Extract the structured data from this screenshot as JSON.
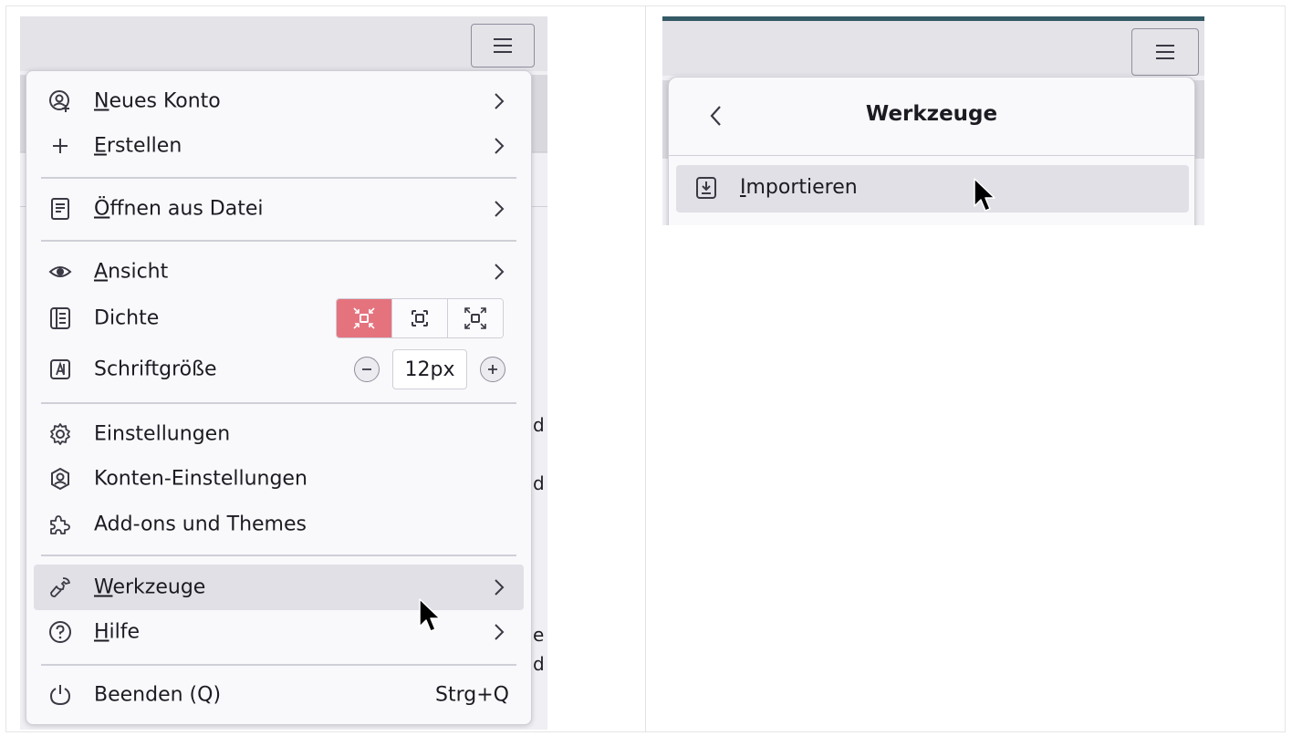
{
  "left_menu": {
    "items": {
      "new_account": {
        "label_u": "N",
        "label_rest": "eues Konto"
      },
      "create": {
        "label_u": "E",
        "label_rest": "rstellen"
      },
      "open_file": {
        "label_u": "Ö",
        "label_rest": "ffnen aus Datei"
      },
      "view": {
        "label_u": "A",
        "label_rest": "nsicht"
      },
      "density": {
        "label": "Dichte"
      },
      "font_size": {
        "label": "Schriftgröße",
        "value": "12px"
      },
      "settings": {
        "label": "Einstellungen"
      },
      "account_settings": {
        "label": "Konten-Einstellungen"
      },
      "addons": {
        "label": "Add-ons und Themes"
      },
      "tools": {
        "label_u": "W",
        "label_rest": "erkzeuge"
      },
      "help": {
        "label_u": "H",
        "label_rest": "ilfe"
      },
      "quit": {
        "label": "Beenden (Q)",
        "shortcut": "Strg+Q"
      }
    },
    "background_fragments": [
      "d",
      "d",
      "e",
      "d"
    ]
  },
  "right_panel": {
    "title": "Werkzeuge",
    "item": {
      "label_u": "I",
      "label_rest": "mportieren"
    }
  },
  "colors": {
    "accent_active": "#e5737e",
    "hover": "#e0e0e6",
    "top_bar": "#345a66"
  }
}
